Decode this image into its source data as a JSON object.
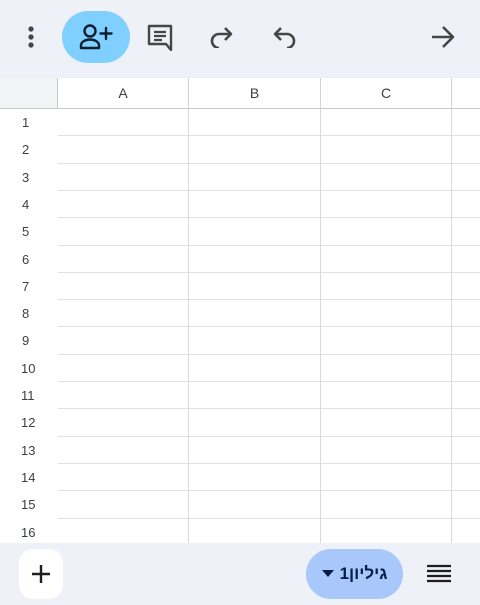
{
  "toolbar": {
    "icons": [
      "more-vert-icon",
      "person-add-icon",
      "comment-icon",
      "redo-icon",
      "undo-icon",
      "arrow-forward-icon"
    ],
    "share_bg_color": "#7fd0ff",
    "bg_color": "#eef1f7"
  },
  "grid": {
    "columns": [
      "A",
      "B",
      "C"
    ],
    "rows": [
      "1",
      "2",
      "3",
      "4",
      "5",
      "6",
      "7",
      "8",
      "9",
      "10",
      "11",
      "12",
      "13",
      "14",
      "15",
      "16"
    ]
  },
  "bottombar": {
    "sheet_tab_label": "גיליון1",
    "sheet_tab_color": "#a8c7fa",
    "icons": [
      "add-icon",
      "dropdown-arrow-icon",
      "sheet-list-icon"
    ]
  }
}
